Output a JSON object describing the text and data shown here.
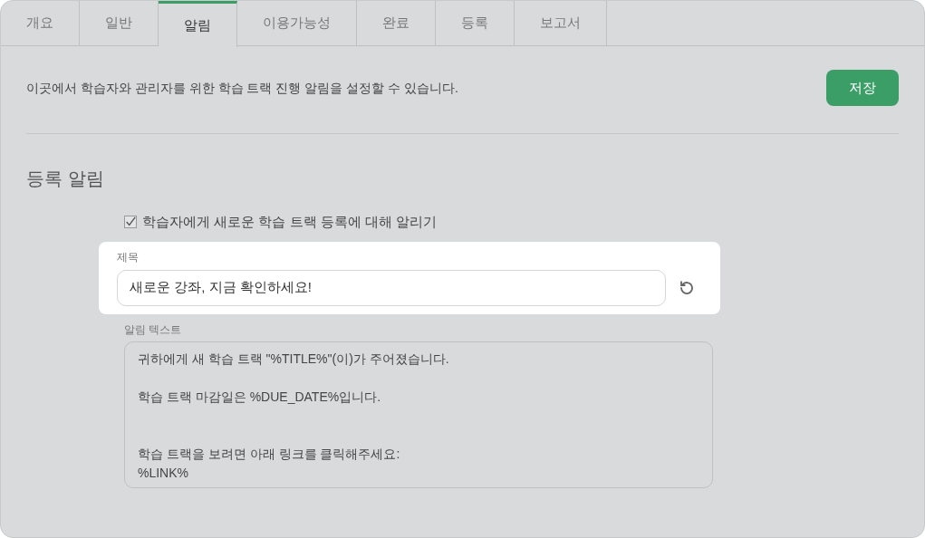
{
  "tabs": [
    {
      "label": "개요",
      "selected": false
    },
    {
      "label": "일반",
      "selected": false
    },
    {
      "label": "알림",
      "selected": true
    },
    {
      "label": "이용가능성",
      "selected": false
    },
    {
      "label": "완료",
      "selected": false
    },
    {
      "label": "등록",
      "selected": false
    },
    {
      "label": "보고서",
      "selected": false
    }
  ],
  "intro": "이곳에서 학습자와 관리자를 위한 학습 트랙 진행 알림을 설정할 수 있습니다.",
  "save_button": "저장",
  "section": {
    "title": "등록 알림",
    "notify": {
      "label": "학습자에게 새로운 학습 트랙 등록에 대해 알리기",
      "checked": true
    },
    "subject": {
      "label": "제목",
      "value": "새로운 강좌, 지금 확인하세요!"
    },
    "message": {
      "label": "알림 텍스트",
      "value": "귀하에게 새 학습 트랙 \"%TITLE%\"(이)가 주어졌습니다.\n\n학습 트랙 마감일은 %DUE_DATE%입니다.\n\n\n학습 트랙을 보려면 아래 링크를 클릭해주세요:\n%LINK%"
    }
  }
}
